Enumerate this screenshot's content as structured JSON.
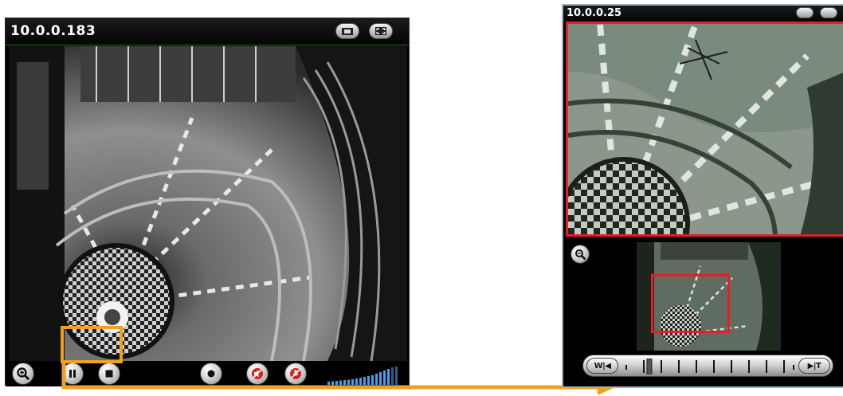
{
  "left_viewer": {
    "title": "10.0.0.183",
    "titlebar_buttons": [
      "snapshot-icon",
      "fullscreen-icon"
    ],
    "controls": [
      "zoom-icon",
      "pause-icon",
      "stop-icon",
      "record-icon",
      "mute-speaker-icon",
      "mute-mic-icon",
      "volume-level-icon"
    ],
    "volume_level": 0.85
  },
  "right_viewer": {
    "title": "10.0.0.25",
    "titlebar_buttons": [
      "snapshot-icon",
      "fullscreen-icon"
    ],
    "zoom_button": "zoom-out-icon",
    "timeline": {
      "back_label": "W|◀",
      "forward_label": "▶|T"
    }
  },
  "annotation": {
    "highlight_color": "#f2a01f",
    "roi_color": "#e81e25"
  }
}
